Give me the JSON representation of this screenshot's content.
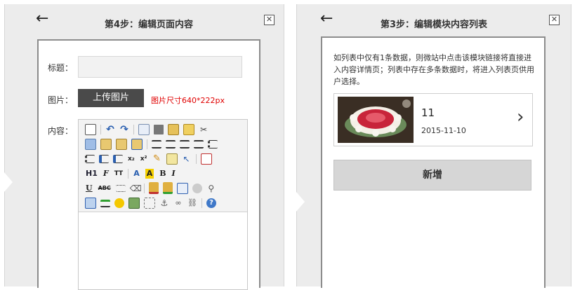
{
  "step4": {
    "back_icon": "←",
    "title": "第4步：编辑页面内容",
    "close_icon": "✕",
    "title_label": "标题：",
    "title_value": "",
    "image_label": "图片：",
    "upload_label": "上传图片",
    "size_hint": "图片尺寸640*222px",
    "content_label": "内容：",
    "toolbar_text": {
      "heading": "H1",
      "font_family": "F",
      "font_size": "TT",
      "font_color": "A",
      "highlight": "A",
      "bold": "B",
      "italic": "I",
      "underline": "U",
      "strikethrough": "ABC",
      "subscript": "x₂",
      "superscript": "x²"
    }
  },
  "step3": {
    "back_icon": "←",
    "title": "第3步：编辑模块内容列表",
    "close_icon": "✕",
    "description": "如列表中仅有1条数据，则微站中点击该模块链接将直接进入内容详情页；列表中存在多条数据时，将进入列表页供用户选择。",
    "item": {
      "number": "11",
      "date": "2015-11-10",
      "chevron": "›"
    },
    "add_label": "新增"
  },
  "colors": {
    "panel_bg": "#ececec",
    "upload_button": "#4a4a4a",
    "size_hint": "#e00000",
    "add_button": "#d6d6d6"
  }
}
